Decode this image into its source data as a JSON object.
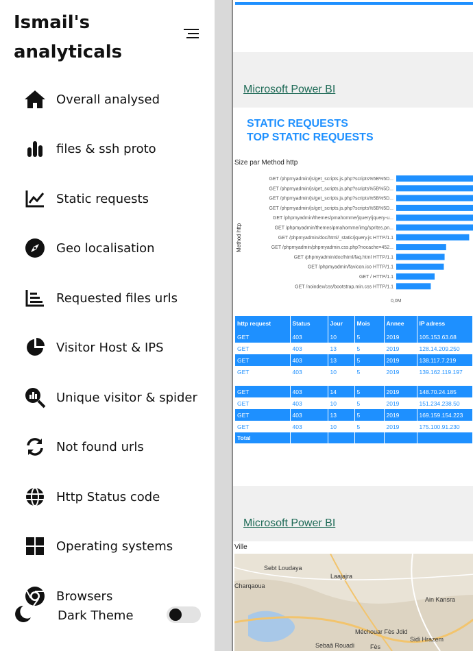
{
  "sidebar": {
    "brand": "Ismail's analyticals",
    "items": [
      {
        "label": "Overall analysed",
        "icon": "home-icon"
      },
      {
        "label": "files & ssh proto",
        "icon": "bar-chart-icon"
      },
      {
        "label": "Static requests",
        "icon": "line-chart-icon"
      },
      {
        "label": "Geo localisation",
        "icon": "compass-icon"
      },
      {
        "label": "Requested files urls",
        "icon": "list-chart-icon"
      },
      {
        "label": "Visitor Host & IPS",
        "icon": "pie-chart-icon"
      },
      {
        "label": "Unique visitor & spider",
        "icon": "search-chart-icon"
      },
      {
        "label": "Not found urls",
        "icon": "refresh-icon"
      },
      {
        "label": "Http Status code",
        "icon": "globe-icon"
      },
      {
        "label": "Operating systems",
        "icon": "windows-icon"
      },
      {
        "label": "Browsers",
        "icon": "chrome-icon"
      }
    ],
    "dark_theme_label": "Dark Theme"
  },
  "panels": {
    "pbi_label_1": "Microsoft Power BI",
    "pbi_label_2": "Microsoft Power BI",
    "title_line1": "STATIC REQUESTS",
    "title_line2": "TOP STATIC REQUESTS"
  },
  "chart_data": {
    "type": "bar",
    "title": "Size par Method http",
    "ylabel": "Method http",
    "xtick_label": "0,0M",
    "categories": [
      "GET /phpmyadmin/js/get_scripts.js.php?scripts%5B%5D...",
      "GET /phpmyadmin/js/get_scripts.js.php?scripts%5B%5D...",
      "GET /phpmyadmin/js/get_scripts.js.php?scripts%5B%5D...",
      "GET /phpmyadmin/js/get_scripts.js.php?scripts%5B%5D...",
      "GET /phpmyadmin/themes/pmahomme/jquery/jquery-u...",
      "GET /phpmyadmin/themes/pmahomme/img/sprites.pn...",
      "GET /phpmyadmin/doc/html/_static/jquery.js HTTP/1.1",
      "GET /phpmyadmin/phpmyadmin.css.php?nocache=452...",
      "GET /phpmyadmin/doc/html/faq.html HTTP/1.1",
      "GET /phpmyadmin/favicon.ico HTTP/1.1",
      "GET / HTTP/1.1",
      "GET /noindex/css/bootstrap.min.css HTTP/1.1"
    ],
    "values": [
      100,
      100,
      100,
      100,
      100,
      100,
      95,
      65,
      63,
      62,
      50,
      45
    ]
  },
  "table": {
    "headers": [
      "http request",
      "Status",
      "Jour",
      "Mois",
      "Annee",
      "IP adress"
    ],
    "rows": [
      {
        "style": "dark",
        "cells": [
          "GET",
          "403",
          "10",
          "5",
          "2019",
          "105.153.63.68"
        ]
      },
      {
        "style": "light",
        "cells": [
          "GET",
          "403",
          "13",
          "5",
          "2019",
          "128.14.209.250"
        ]
      },
      {
        "style": "dark",
        "cells": [
          "GET",
          "403",
          "13",
          "5",
          "2019",
          "138.117.7.219"
        ]
      },
      {
        "style": "light",
        "cells": [
          "GET",
          "403",
          "10",
          "5",
          "2019",
          "139.162.119.197"
        ]
      },
      {
        "style": "gap",
        "cells": [
          "",
          "",
          "",
          "",
          "",
          ""
        ]
      },
      {
        "style": "dark",
        "cells": [
          "GET",
          "403",
          "14",
          "5",
          "2019",
          "148.70.24.185"
        ]
      },
      {
        "style": "light",
        "cells": [
          "GET",
          "403",
          "10",
          "5",
          "2019",
          "151.234.238.50"
        ]
      },
      {
        "style": "dark",
        "cells": [
          "GET",
          "403",
          "13",
          "5",
          "2019",
          "169.159.154.223"
        ]
      },
      {
        "style": "light",
        "cells": [
          "GET",
          "403",
          "10",
          "5",
          "2019",
          "175.100.91.230"
        ]
      }
    ],
    "total_label": "Total"
  },
  "map": {
    "title": "Ville",
    "places": [
      "Sebt Loudaya",
      "Laajajra",
      "Charqaoua",
      "Ain Kansra",
      "Méchouar Fès Jdid",
      "Sidi Hrazem",
      "Sebaâ Rouadi",
      "Fès"
    ]
  },
  "colors": {
    "accent": "#1e90ff",
    "link": "#1f6b57"
  }
}
